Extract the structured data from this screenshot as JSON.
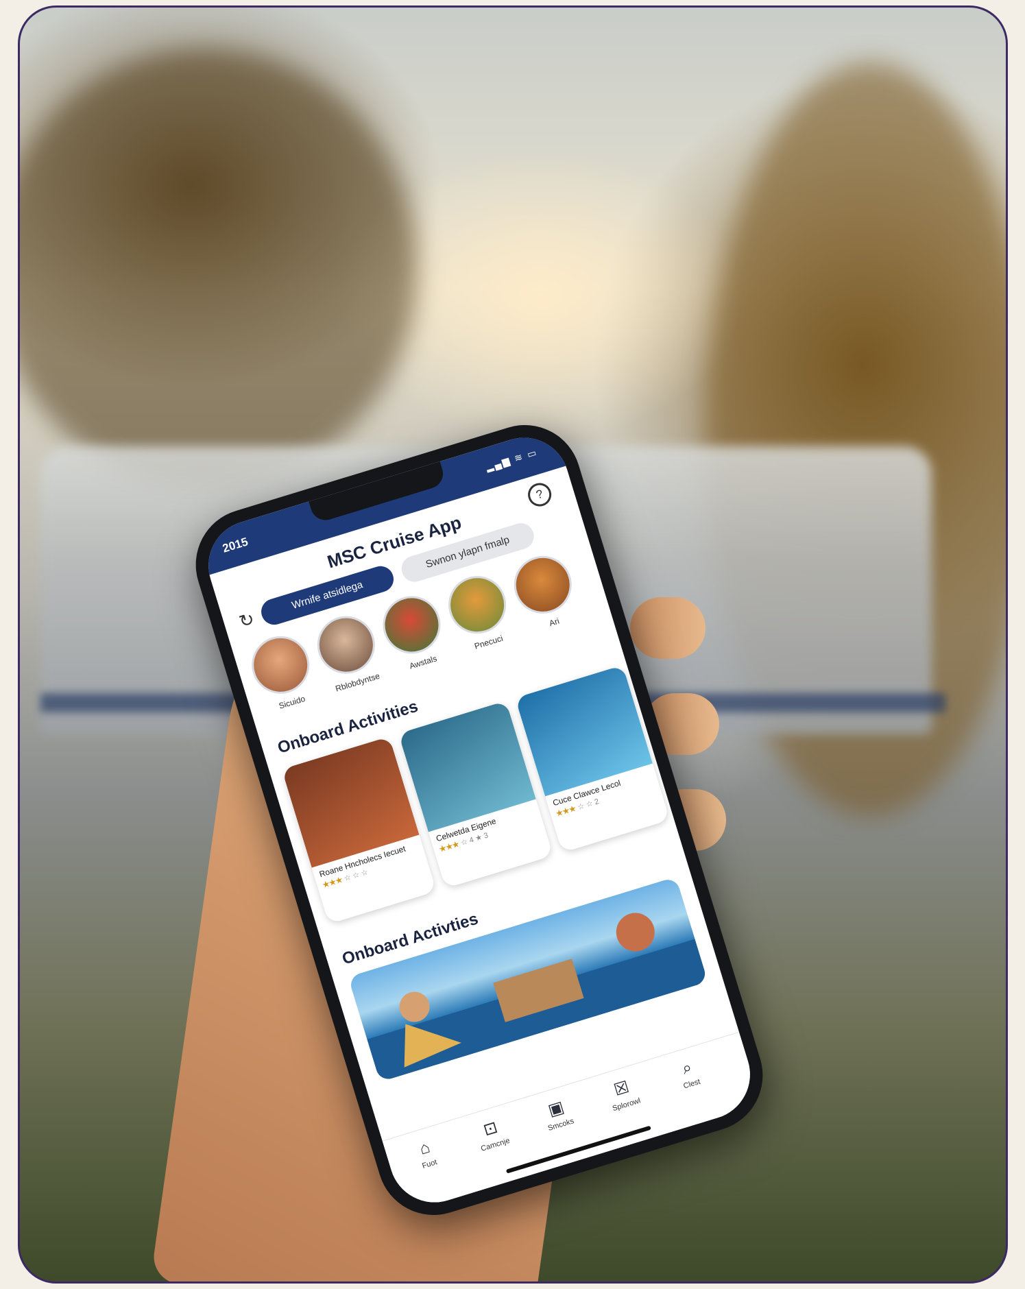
{
  "app": {
    "title": "MSC Cruise App",
    "status_time": "2015",
    "status_icons": "▂▄▆ ≋ ▭"
  },
  "chips": [
    {
      "label": "Wrnife atsidlega",
      "active": true
    },
    {
      "label": "Swnon ylapn fmalp",
      "active": false
    }
  ],
  "stories": [
    {
      "label": "Sicuido",
      "color": "#c9815a"
    },
    {
      "label": "Rblobdyntse",
      "color": "#8a6a55"
    },
    {
      "label": "Awstals",
      "color": "#b0332a"
    },
    {
      "label": "Pnecuci",
      "color": "#c77a2e"
    },
    {
      "label": "Ari",
      "color": "#b8692f"
    }
  ],
  "sections": {
    "activities_1": "Onboard Activities",
    "activities_2": "Onboard Activties"
  },
  "cards": [
    {
      "title": "Roane Hncholecs Iecuet",
      "stars": "★★★",
      "rest": "☆ ☆ ☆",
      "colors": [
        "#7a3a22",
        "#c8673a"
      ]
    },
    {
      "title": "Celwetda Eigene",
      "stars": "★★★",
      "rest": "☆ 4 ★ 3",
      "colors": [
        "#2c6b8a",
        "#6fb8cf"
      ]
    },
    {
      "title": "Cuce Clawce Lecol",
      "stars": "★★★",
      "rest": "☆ ☆ 2",
      "colors": [
        "#1f6fa8",
        "#6cc3e8"
      ]
    }
  ],
  "tabs": [
    {
      "label": "Fuot",
      "icon": "⌂",
      "icon_name": "home-icon"
    },
    {
      "label": "Camcnje",
      "icon": "⊡",
      "icon_name": "calendar-icon"
    },
    {
      "label": "Smcoks",
      "icon": "▣",
      "icon_name": "screen-icon"
    },
    {
      "label": "Splorowl",
      "icon": "☒",
      "icon_name": "map-icon"
    },
    {
      "label": "Clest",
      "icon": "⌕",
      "icon_name": "search-icon"
    }
  ]
}
